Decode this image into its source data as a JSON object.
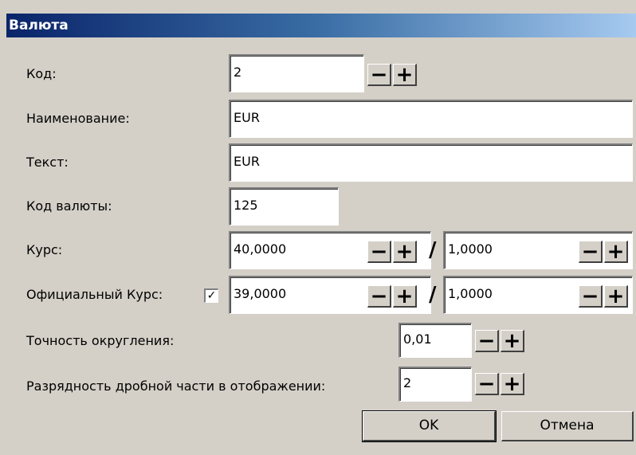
{
  "window": {
    "title": "Валюта"
  },
  "form": {
    "code": {
      "label": "Код:",
      "value": "2"
    },
    "name": {
      "label": "Наименование:",
      "value": "EUR"
    },
    "text": {
      "label": "Текст:",
      "value": "EUR"
    },
    "currency_code": {
      "label": "Код валюты:",
      "value": "125"
    },
    "rate": {
      "label": "Курс:",
      "value": "40,0000",
      "divisor": "1,0000",
      "separator": "/"
    },
    "official_rate": {
      "label": "Официальный Курс:",
      "checked": true,
      "check_mark": "✓",
      "value": "39,0000",
      "divisor": "1,0000",
      "separator": "/"
    },
    "rounding": {
      "label": "Точность округления:",
      "value": "0,01"
    },
    "decimals": {
      "label": "Разрядность дробной части в отображении:",
      "value": "2"
    }
  },
  "spinner": {
    "minus": "−",
    "plus": "+"
  },
  "buttons": {
    "ok": "OK",
    "cancel": "Отмена"
  }
}
